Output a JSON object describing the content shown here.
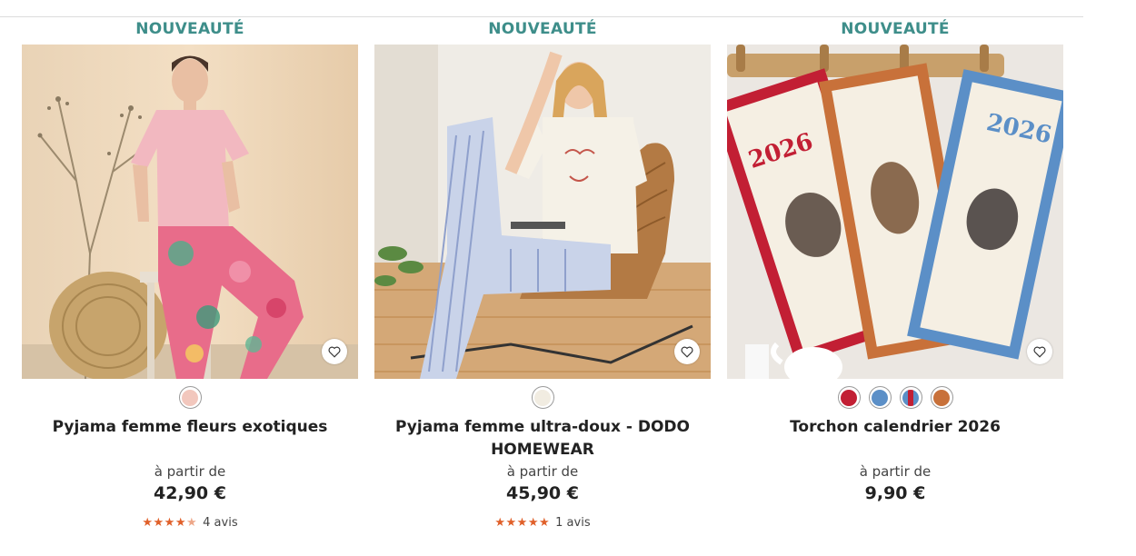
{
  "products": [
    {
      "badge": "NOUVEAUTÉ",
      "title": "Pyjama femme fleurs exotiques",
      "price_prefix": "à partir de",
      "price": "42,90 €",
      "rating": 4.5,
      "reviews": "4 avis",
      "swatches": [
        "#f2c7bd"
      ],
      "favorite_icon": "heart-outline-icon"
    },
    {
      "badge": "NOUVEAUTÉ",
      "title": "Pyjama femme ultra-doux - DODO HOMEWEAR",
      "price_prefix": "à partir de",
      "price": "45,90 €",
      "rating": 5,
      "reviews": "1 avis",
      "swatches": [
        "#f1ece1"
      ],
      "favorite_icon": "heart-outline-icon"
    },
    {
      "badge": "NOUVEAUTÉ",
      "title": "Torchon calendrier 2026",
      "price_prefix": "à partir de",
      "price": "9,90 €",
      "swatches": [
        "#c21f34",
        "#5b8fc7",
        "split:#c21f34|#5b8fc7",
        "#c8713a"
      ],
      "favorite_icon": "heart-outline-icon"
    }
  ],
  "image_text": {
    "towel_year": "2026"
  },
  "colors": {
    "badge": "#3e8e8a",
    "stars": "#e0602a"
  }
}
